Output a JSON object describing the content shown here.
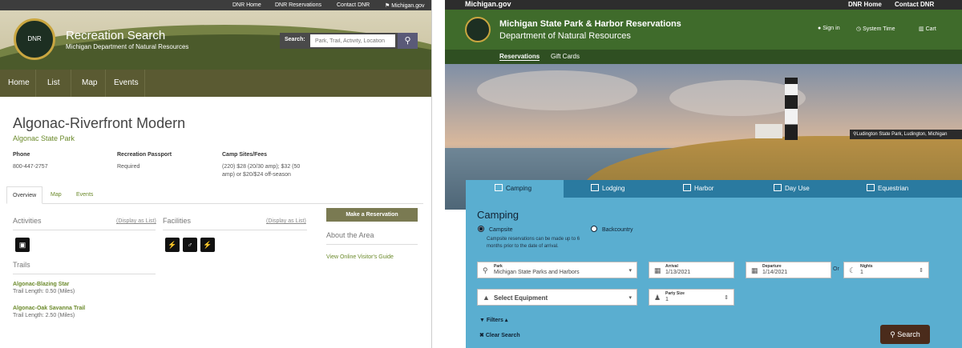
{
  "left": {
    "topbar": [
      "DNR Home",
      "DNR Reservations",
      "Contact DNR",
      "Michigan.gov"
    ],
    "seal_text": "DNR",
    "title": "Recreation Search",
    "subtitle": "Michigan Department of Natural Resources",
    "search": {
      "label": "Search:",
      "placeholder": "Park, Trail, Activity, Location",
      "icon": "search-icon"
    },
    "nav": [
      "Home",
      "List",
      "Map",
      "Events"
    ],
    "park_name": "Algonac-Riverfront Modern",
    "park_sub": "Algonac State Park",
    "info": [
      {
        "h": "Phone",
        "v": "800-447-2757"
      },
      {
        "h": "Recreation Passport",
        "v": "Required"
      },
      {
        "h": "Camp Sites/Fees",
        "v": "(220) $28 (20/30 amp); $32 (50 amp) or $20/$24 off-season"
      }
    ],
    "tabs": [
      "Overview",
      "Map",
      "Events"
    ],
    "activities": "Activities",
    "facilities": "Facilities",
    "display_list": "(Display as List)",
    "trails_heading": "Trails",
    "trails": [
      {
        "name": "Algonac-Blazing Star",
        "length": "Trail Length: 0.50 (Miles)"
      },
      {
        "name": "Algonac-Oak Savanna Trail",
        "length": "Trail Length: 2.50 (Miles)"
      }
    ],
    "reserve": "Make a Reservation",
    "about": "About the Area",
    "guide": "View Online Visitor's Guide"
  },
  "right": {
    "brand": "Michigan.gov",
    "toplinks": [
      "DNR Home",
      "Contact DNR"
    ],
    "title": "Michigan State Park & Harbor Reservations",
    "subtitle": "Department of Natural Resources",
    "header_links": [
      "Sign in",
      "System Time",
      "Cart"
    ],
    "subnav": [
      "Reservations",
      "Gift Cards"
    ],
    "location": "Ludington State Park, Ludington, Michigan",
    "tabs": [
      "Camping",
      "Lodging",
      "Harbor",
      "Day Use",
      "Equestrian"
    ],
    "panel_title": "Camping",
    "radio": [
      "Campsite",
      "Backcountry"
    ],
    "note": "Campsite reservations can be made up to 6 months prior to the date of arrival.",
    "park": {
      "label": "Park",
      "value": "Michigan State Parks and Harbors"
    },
    "arrival": {
      "label": "Arrival",
      "value": "1/13/2021"
    },
    "departure": {
      "label": "Departure",
      "value": "1/14/2021"
    },
    "or": "Or",
    "nights": {
      "label": "Nights",
      "value": "1"
    },
    "equipment": "Select Equipment",
    "party": {
      "label": "Party Size",
      "value": "1"
    },
    "filters": "Filters",
    "clear": "Clear Search",
    "search": "Search",
    "colors": {
      "header_green": "#3f6b2b",
      "panel_blue": "#5aaed0",
      "tab_blue": "#2a7aa0",
      "search_brown": "#4a2b1b"
    }
  }
}
